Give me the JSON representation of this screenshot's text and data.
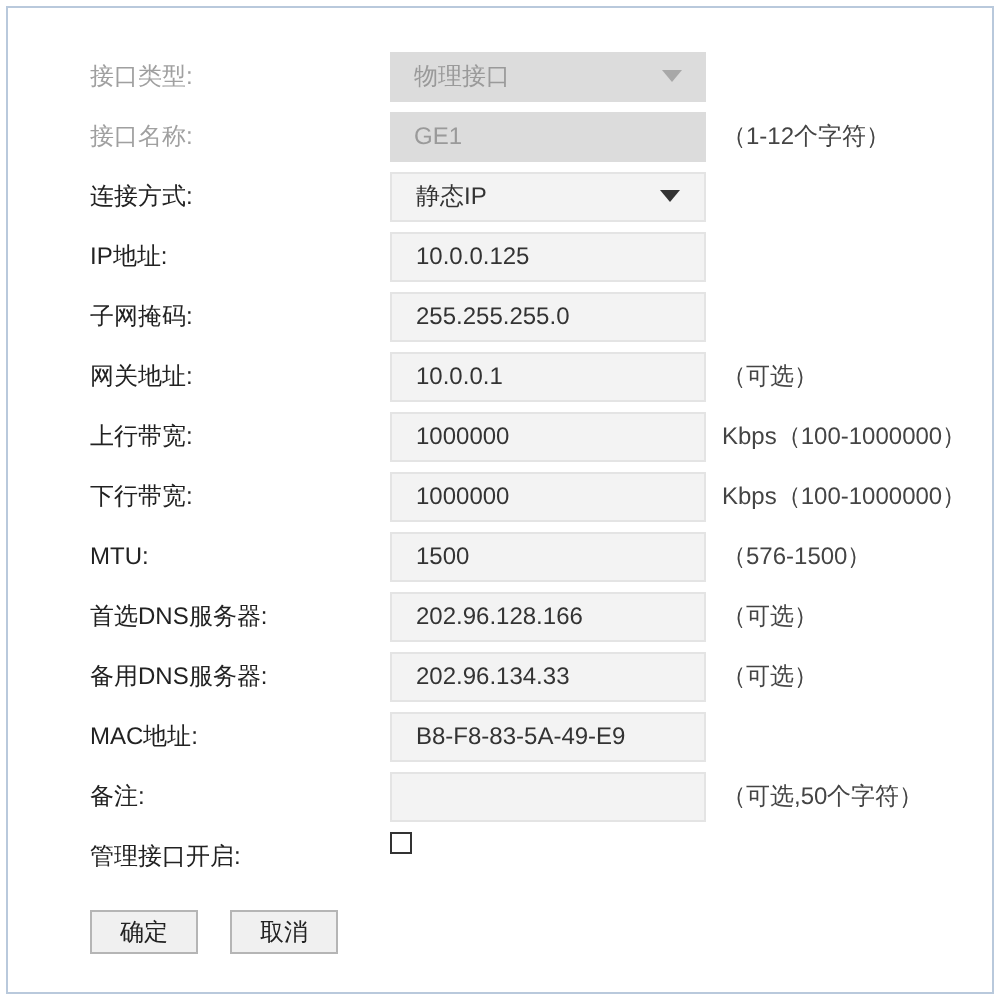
{
  "fields": [
    {
      "label": "接口类型:",
      "kind": "select",
      "value": "物理接口",
      "disabled": true
    },
    {
      "label": "接口名称:",
      "kind": "text",
      "value": "GE1",
      "disabled": true,
      "hint": "（1-12个字符）"
    },
    {
      "label": "连接方式:",
      "kind": "select",
      "value": "静态IP",
      "disabled": false
    },
    {
      "label": "IP地址:",
      "kind": "text",
      "value": "10.0.0.125",
      "disabled": false
    },
    {
      "label": "子网掩码:",
      "kind": "text",
      "value": "255.255.255.0",
      "disabled": false
    },
    {
      "label": "网关地址:",
      "kind": "text",
      "value": "10.0.0.1",
      "disabled": false,
      "hint": "（可选）"
    },
    {
      "label": "上行带宽:",
      "kind": "text",
      "value": "1000000",
      "disabled": false,
      "hint": "Kbps（100-1000000）"
    },
    {
      "label": "下行带宽:",
      "kind": "text",
      "value": "1000000",
      "disabled": false,
      "hint": "Kbps（100-1000000）"
    },
    {
      "label": "MTU:",
      "kind": "text",
      "value": "1500",
      "disabled": false,
      "hint": "（576-1500）"
    },
    {
      "label": "首选DNS服务器:",
      "kind": "text",
      "value": "202.96.128.166",
      "disabled": false,
      "hint": "（可选）"
    },
    {
      "label": "备用DNS服务器:",
      "kind": "text",
      "value": "202.96.134.33",
      "disabled": false,
      "hint": "（可选）"
    },
    {
      "label": "MAC地址:",
      "kind": "text",
      "value": "B8-F8-83-5A-49-E9",
      "disabled": false
    },
    {
      "label": "备注:",
      "kind": "text",
      "disabled": false,
      "hint": "（可选,50个字符）"
    },
    {
      "label": "管理接口开启:",
      "kind": "checkbox",
      "checked": false
    }
  ],
  "buttons": [
    "确定",
    "取消"
  ]
}
